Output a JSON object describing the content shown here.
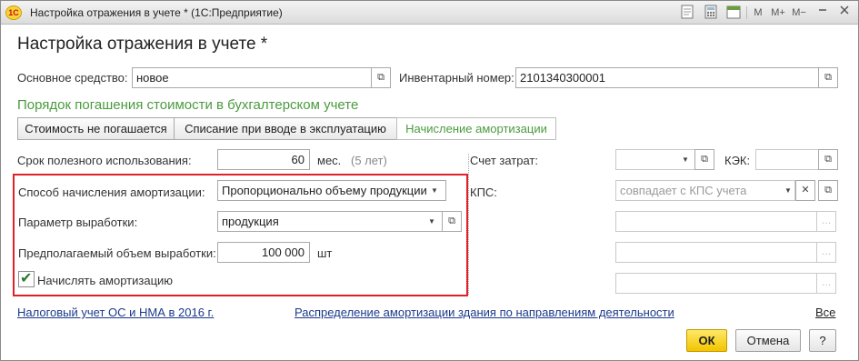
{
  "window": {
    "title": "Настройка отражения в учете * (1С:Предприятие)",
    "logo_text": "1С",
    "toolbar": {
      "m": "M",
      "m_plus": "M+",
      "m_minus": "M−",
      "calendar_day": "31"
    }
  },
  "form": {
    "title": "Настройка отражения в учете *",
    "fixed_asset": {
      "label": "Основное средство:",
      "value": "новое"
    },
    "inventory_number": {
      "label": "Инвентарный номер:",
      "value": "2101340300001"
    },
    "section_title": "Порядок погашения стоимости в бухгалтерском учете",
    "tabs": [
      {
        "label": "Стоимость не погашается"
      },
      {
        "label": "Списание при вводе в эксплуатацию"
      },
      {
        "label": "Начисление амортизации"
      }
    ],
    "useful_life": {
      "label": "Срок полезного использования:",
      "value": "60",
      "unit": "мес.",
      "hint": "(5 лет)"
    },
    "cost_account": {
      "label": "Счет затрат:",
      "value": ""
    },
    "kek": {
      "label": "КЭК:",
      "value": ""
    },
    "method": {
      "label": "Способ начисления амортизации:",
      "value": "Пропорционально объему продукции"
    },
    "kps": {
      "label": "КПС:",
      "placeholder": "совпадает с КПС учета"
    },
    "output_param": {
      "label": "Параметр выработки:",
      "value": "продукция"
    },
    "expected_volume": {
      "label": "Предполагаемый объем выработки:",
      "value": "100 000",
      "unit": "шт"
    },
    "accrue": {
      "label": "Начислять амортизацию",
      "checked": true
    },
    "links": {
      "tax_accounting": "Налоговый учет ОС и НМА в 2016 г.",
      "distribution": "Распределение амортизации здания по направлениям деятельности",
      "all": "Все"
    },
    "buttons": {
      "ok": "ОК",
      "cancel": "Отмена",
      "help": "?"
    }
  },
  "colors": {
    "accent_green": "#4a9b3e",
    "highlight_red": "#e0202a",
    "ok_yellow": "#f3c400",
    "link_blue": "#1c3a8a"
  }
}
